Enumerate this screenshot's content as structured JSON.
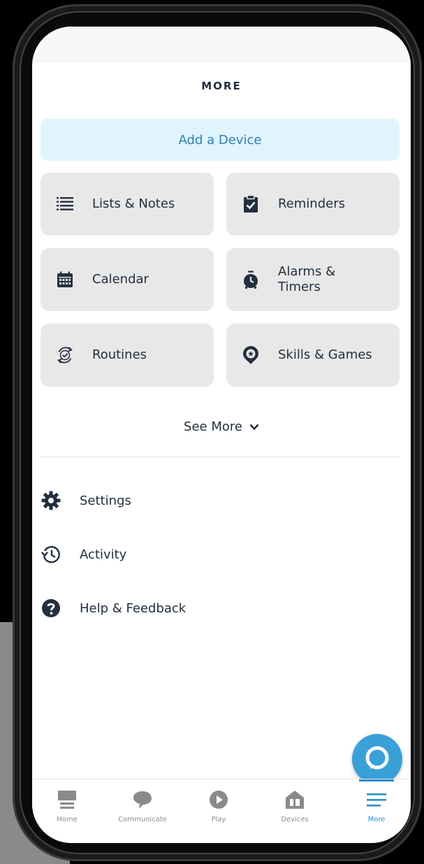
{
  "header": {
    "title": "MORE"
  },
  "add_device": {
    "label": "Add a Device"
  },
  "tiles": [
    {
      "label": "Lists & Notes",
      "icon": "list-icon"
    },
    {
      "label": "Reminders",
      "icon": "clipboard-check-icon"
    },
    {
      "label": "Calendar",
      "icon": "calendar-icon"
    },
    {
      "label": "Alarms & Timers",
      "icon": "alarm-clock-icon"
    },
    {
      "label": "Routines",
      "icon": "routines-icon"
    },
    {
      "label": "Skills & Games",
      "icon": "skills-icon"
    }
  ],
  "see_more": {
    "label": "See More"
  },
  "menu": [
    {
      "label": "Settings",
      "icon": "gear-icon"
    },
    {
      "label": "Activity",
      "icon": "history-icon"
    },
    {
      "label": "Help & Feedback",
      "icon": "help-icon"
    }
  ],
  "tabs": [
    {
      "label": "Home",
      "icon": "home-icon"
    },
    {
      "label": "Communicate",
      "icon": "chat-bubble-icon"
    },
    {
      "label": "Play",
      "icon": "play-icon"
    },
    {
      "label": "Devices",
      "icon": "devices-icon"
    },
    {
      "label": "More",
      "icon": "menu-lines-icon",
      "active": true
    }
  ],
  "colors": {
    "accent": "#2f8fcc",
    "add_device_bg": "#dff4fb",
    "tile_bg": "#e8e8e8",
    "text": "#232f3e",
    "fab": "#3aa0d8"
  }
}
